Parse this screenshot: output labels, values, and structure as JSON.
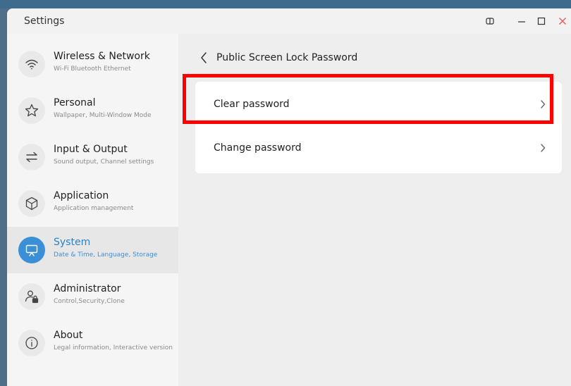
{
  "window": {
    "title": "Settings"
  },
  "sidebar": {
    "items": [
      {
        "title": "Wireless & Network",
        "subtitle": "Wi-Fi Bluetooth Ethernet",
        "icon": "wifi-icon",
        "active": false
      },
      {
        "title": "Personal",
        "subtitle": "Wallpaper, Multi-Window Mode",
        "icon": "star-icon",
        "active": false
      },
      {
        "title": "Input & Output",
        "subtitle": "Sound output, Channel settings",
        "icon": "swap-arrows-icon",
        "active": false
      },
      {
        "title": "Application",
        "subtitle": "Application management",
        "icon": "cube-icon",
        "active": false
      },
      {
        "title": "System",
        "subtitle": "Date & Time, Language, Storage",
        "icon": "monitor-icon",
        "active": true
      },
      {
        "title": "Administrator",
        "subtitle": "Control,Security,Clone",
        "icon": "user-lock-icon",
        "active": false
      },
      {
        "title": "About",
        "subtitle": "Legal information, Interactive version",
        "icon": "info-icon",
        "active": false
      }
    ]
  },
  "main": {
    "page_title": "Public Screen Lock Password",
    "options": [
      {
        "label": "Clear password"
      },
      {
        "label": "Change password"
      }
    ]
  },
  "colors": {
    "accent": "#3a8fd6",
    "highlight": "#ff0000",
    "close": "#e06060"
  }
}
